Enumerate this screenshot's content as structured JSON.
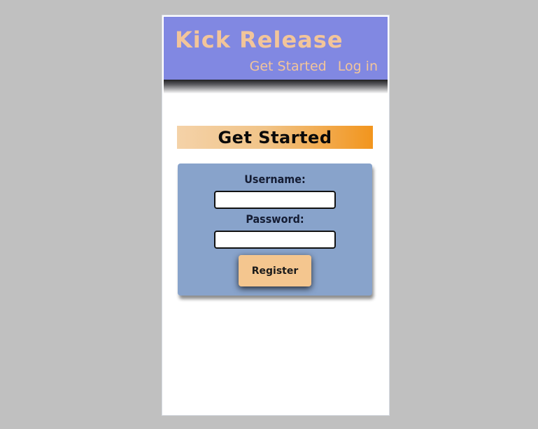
{
  "header": {
    "site_title": "Kick Release",
    "nav": [
      {
        "label": "Get Started"
      },
      {
        "label": "Log in"
      }
    ]
  },
  "main": {
    "heading": "Get Started",
    "form": {
      "username_label": "Username:",
      "username_value": "",
      "password_label": "Password:",
      "password_value": "",
      "register_label": "Register"
    }
  },
  "colors": {
    "page_background": "#c0c0c0",
    "header_background": "#8188e2",
    "header_text": "#f2c59a",
    "form_card": "#88a3cb",
    "button": "#f4c68f",
    "heading_gradient_end": "#f2951d"
  }
}
